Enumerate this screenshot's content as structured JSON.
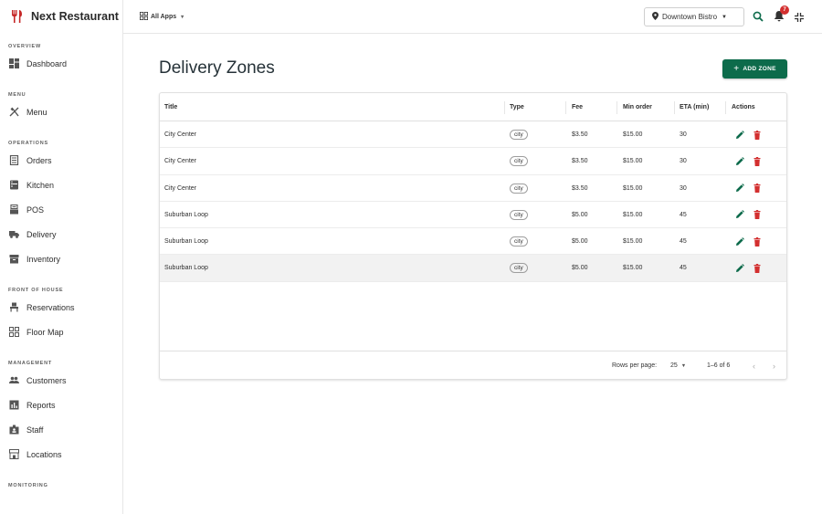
{
  "brand": {
    "name": "Next Restaurant"
  },
  "sidebar": {
    "sections": [
      {
        "title": "OVERVIEW",
        "items": [
          {
            "label": "Dashboard",
            "icon": "dashboard-icon"
          }
        ]
      },
      {
        "title": "MENU",
        "items": [
          {
            "label": "Menu",
            "icon": "utensils-icon"
          }
        ]
      },
      {
        "title": "OPERATIONS",
        "items": [
          {
            "label": "Orders",
            "icon": "receipt-icon"
          },
          {
            "label": "Kitchen",
            "icon": "kitchen-icon"
          },
          {
            "label": "POS",
            "icon": "pos-icon"
          },
          {
            "label": "Delivery",
            "icon": "truck-icon"
          },
          {
            "label": "Inventory",
            "icon": "inventory-icon"
          }
        ]
      },
      {
        "title": "FRONT OF HOUSE",
        "items": [
          {
            "label": "Reservations",
            "icon": "chair-icon"
          },
          {
            "label": "Floor Map",
            "icon": "grid-icon"
          }
        ]
      },
      {
        "title": "MANAGEMENT",
        "items": [
          {
            "label": "Customers",
            "icon": "people-icon"
          },
          {
            "label": "Reports",
            "icon": "chart-icon"
          },
          {
            "label": "Staff",
            "icon": "badge-icon"
          },
          {
            "label": "Locations",
            "icon": "store-icon"
          }
        ]
      },
      {
        "title": "MONITORING",
        "items": []
      }
    ]
  },
  "topbar": {
    "apps_label": "All Apps",
    "location": "Downtown Bistro",
    "notification_count": "7"
  },
  "page": {
    "title": "Delivery Zones",
    "add_button": "ADD ZONE"
  },
  "table": {
    "columns": [
      "Title",
      "Type",
      "Fee",
      "Min order",
      "ETA (min)",
      "Actions"
    ],
    "rows": [
      {
        "title": "City Center",
        "type": "city",
        "fee": "$3.50",
        "min_order": "$15.00",
        "eta": "30"
      },
      {
        "title": "City Center",
        "type": "city",
        "fee": "$3.50",
        "min_order": "$15.00",
        "eta": "30"
      },
      {
        "title": "City Center",
        "type": "city",
        "fee": "$3.50",
        "min_order": "$15.00",
        "eta": "30"
      },
      {
        "title": "Suburban Loop",
        "type": "city",
        "fee": "$5.00",
        "min_order": "$15.00",
        "eta": "45"
      },
      {
        "title": "Suburban Loop",
        "type": "city",
        "fee": "$5.00",
        "min_order": "$15.00",
        "eta": "45"
      },
      {
        "title": "Suburban Loop",
        "type": "city",
        "fee": "$5.00",
        "min_order": "$15.00",
        "eta": "45"
      }
    ],
    "footer": {
      "rows_per_page_label": "Rows per page:",
      "rows_per_page": "25",
      "range": "1–6 of 6"
    }
  },
  "colors": {
    "accent": "#0d6b4b",
    "danger": "#d32f2f",
    "brand_icon": "#c62828"
  }
}
